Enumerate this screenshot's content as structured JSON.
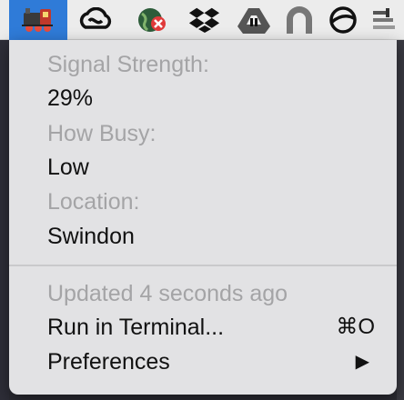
{
  "menubar": {
    "items": [
      {
        "icon": "train-icon",
        "active": true
      },
      {
        "icon": "creative-cloud-icon"
      },
      {
        "icon": "globe-blocked-icon"
      },
      {
        "icon": "dropbox-icon"
      },
      {
        "icon": "google-drive-icon"
      },
      {
        "icon": "arch-icon"
      },
      {
        "icon": "circle-slash-icon"
      },
      {
        "icon": "stack-icon"
      }
    ]
  },
  "menu": {
    "signal_label": "Signal Strength:",
    "signal_value": "29%",
    "busy_label": "How Busy:",
    "busy_value": "Low",
    "location_label": "Location:",
    "location_value": "Swindon",
    "updated": "Updated 4 seconds ago",
    "run_label": "Run in Terminal...",
    "run_shortcut": "⌘O",
    "preferences_label": "Preferences",
    "submenu_arrow": "▶"
  },
  "colors": {
    "active_highlight": "#2f7bd8",
    "menu_bg": "#e2e2e4",
    "dim_text": "#a4a4a6"
  }
}
